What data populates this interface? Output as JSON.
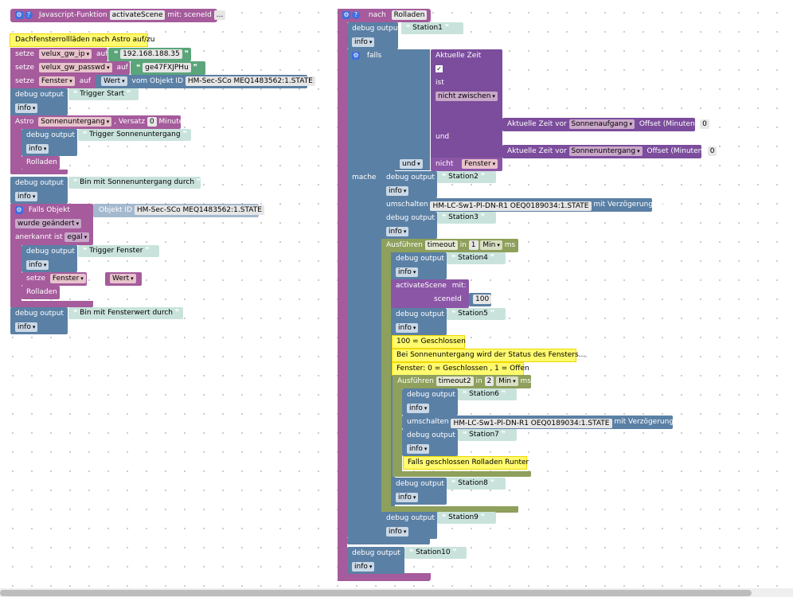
{
  "left": {
    "func": {
      "label": "Javascript-Funktion",
      "name": "activateScene",
      "with": "mit: sceneId",
      "more": "..."
    },
    "comment1": "Dachfensterrollläden nach Astro auf/zu",
    "set1": {
      "kw": "setze",
      "var": "velux_gw_ip",
      "to": "auf",
      "val": "192.168.188.35"
    },
    "set2": {
      "kw": "setze",
      "var": "velux_gw_passwd",
      "to": "auf",
      "val": "ge47FXJPHu"
    },
    "set3": {
      "kw": "setze",
      "var": "Fenster",
      "to": "auf",
      "prop": "Wert",
      "from": "vom Objekt ID",
      "obj": "HM-Sec-SCo MEQ1483562:1.STATE"
    },
    "debug1": {
      "kw": "debug output",
      "val": "Trigger Start",
      "lvl": "info"
    },
    "astro": {
      "kw": "Astro",
      "event": "Sonnenuntergang",
      "offset": ", Versatz",
      "num": "0",
      "unit": "Minuten"
    },
    "debug2": {
      "kw": "debug output",
      "val": "Trigger Sonnenuntergang",
      "lvl": "info"
    },
    "roll1": "Rolladen",
    "debug3": {
      "kw": "debug output",
      "val": "Bin mit Sonnenuntergang durch",
      "lvl": "info"
    },
    "falls": {
      "kw": "Falls Objekt",
      "objLbl": "Objekt ID",
      "obj": "HM-Sec-SCo MEQ1483562:1.STATE",
      "changed": "wurde geändert",
      "ack": "anerkannt ist",
      "ackVal": "egal"
    },
    "debug4": {
      "kw": "debug output",
      "val": "Trigger Fenster",
      "lvl": "info"
    },
    "set4": {
      "kw": "setze",
      "var": "Fenster",
      "to": "auf",
      "prop": "Wert"
    },
    "roll2": "Rolladen",
    "debug5": {
      "kw": "debug output",
      "val": "Bin mit Fensterwert durch",
      "lvl": "info"
    }
  },
  "right": {
    "proc": {
      "kw": "nach",
      "name": "Rolladen"
    },
    "debugS1": {
      "kw": "debug output",
      "val": "Station1",
      "lvl": "info"
    },
    "falls": "falls",
    "cond": {
      "time": "Aktuelle Zeit",
      "ist": "ist",
      "mode": "nicht zwischen",
      "und": "und",
      "t1label": "Aktuelle Zeit vor",
      "t1": "Sonnenaufgang",
      "t1off": "Offset (Minuten)",
      "t1n": "0",
      "t2label": "Aktuelle Zeit vor",
      "t2": "Sonnenuntergang",
      "t2off": "Offset (Minuten)",
      "t2n": "0",
      "und2": "und",
      "nicht": "nicht",
      "var": "Fenster"
    },
    "mache": "mache",
    "debugS2": {
      "kw": "debug output",
      "val": "Station2",
      "lvl": "info"
    },
    "switch1": {
      "kw": "umschalten",
      "obj": "HM-LC-Sw1-Pl-DN-R1 OEQ0189034:1.STATE",
      "delay": "mit Verzögerung"
    },
    "debugS3": {
      "kw": "debug output",
      "val": "Station3",
      "lvl": "info"
    },
    "timeout1": {
      "kw": "Ausführen",
      "name": "timeout",
      "in": "in",
      "num": "1",
      "unit": "Min",
      "ms": "ms"
    },
    "debugS4": {
      "kw": "debug output",
      "val": "Station4",
      "lvl": "info"
    },
    "callScene": {
      "kw": "activateScene",
      "with": "mit:",
      "param": "sceneId",
      "val": "100"
    },
    "debugS5": {
      "kw": "debug output",
      "val": "Station5",
      "lvl": "info"
    },
    "c1": "100 = Geschlossen",
    "c2": "Bei Sonnenuntergang wird der Status des Fensters...",
    "c3": "Fenster: 0 = Geschlossen , 1 = Offen",
    "timeout2": {
      "kw": "Ausführen",
      "name": "timeout2",
      "in": "in",
      "num": "2",
      "unit": "Min",
      "ms": "ms"
    },
    "debugS6": {
      "kw": "debug output",
      "val": "Station6",
      "lvl": "info"
    },
    "switch2": {
      "kw": "umschalten",
      "obj": "HM-LC-Sw1-Pl-DN-R1 OEQ0189034:1.STATE",
      "delay": "mit Verzögerung"
    },
    "debugS7": {
      "kw": "debug output",
      "val": "Station7",
      "lvl": "info"
    },
    "c4": "Falls geschlossen Rolladen Runter",
    "debugS8": {
      "kw": "debug output",
      "val": "Station8",
      "lvl": "info"
    },
    "debugS9": {
      "kw": "debug output",
      "val": "Station9",
      "lvl": "info"
    },
    "debugS10": {
      "kw": "debug output",
      "val": "Station10",
      "lvl": "info"
    }
  },
  "icons": {
    "gear": "gear-icon",
    "help": "help-icon",
    "dropdown": "triangle-down-icon",
    "quote": "quote-icon",
    "check": "checkmark-icon"
  },
  "colors": {
    "procedure": "#a55b9c",
    "debug": "#5b80a5",
    "variable": "#a55b80",
    "text": "#5ba58c",
    "logic": "#8c56a7",
    "timeout": "#8ea05b",
    "comment": "#fffa6e"
  },
  "glyphs": {
    "open": "❝",
    "close": "❞",
    "arrow": "▾",
    "check": "✓",
    "gear": "⚙",
    "help": "?"
  }
}
